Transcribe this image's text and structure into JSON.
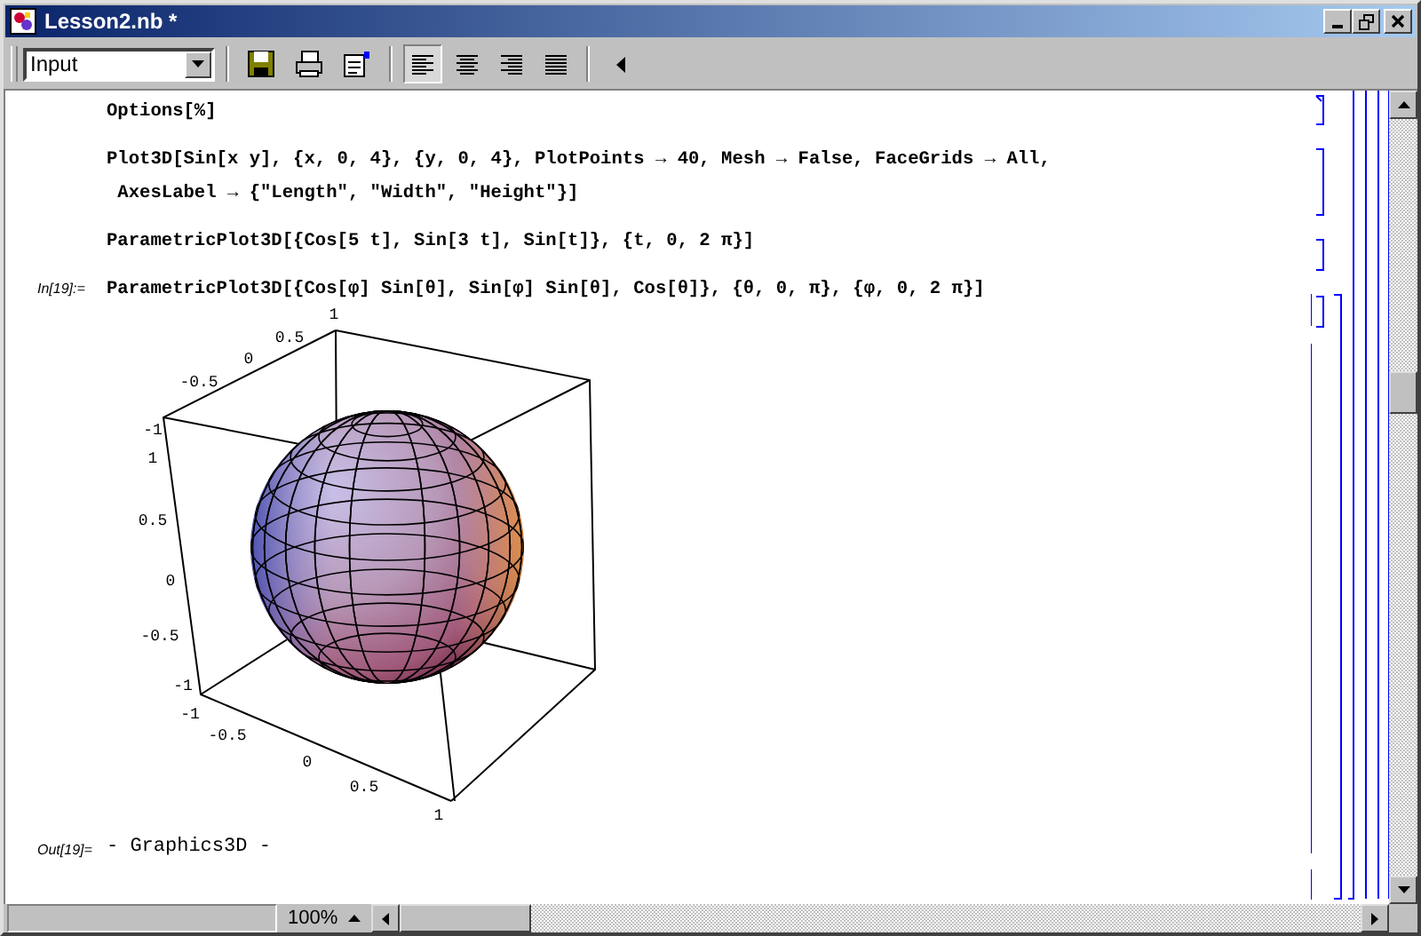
{
  "window": {
    "title": "Lesson2.nb *"
  },
  "toolbar": {
    "style_menu": {
      "value": "Input"
    },
    "align_buttons": [
      {
        "kind": "left",
        "selected": true
      },
      {
        "kind": "center",
        "selected": false
      },
      {
        "kind": "right",
        "selected": false
      },
      {
        "kind": "justify",
        "selected": false
      }
    ]
  },
  "cells": [
    {
      "kind": "input",
      "lines": [
        "Options[%]"
      ]
    },
    {
      "kind": "input",
      "lines": [
        "Plot3D[Sin[x y], {x, 0, 4}, {y, 0, 4}, PlotPoints → 40, Mesh → False, FaceGrids → All,",
        " AxesLabel → {\"Length\", \"Width\", \"Height\"}]"
      ]
    },
    {
      "kind": "input",
      "lines": [
        "ParametricPlot3D[{Cos[5 t], Sin[3 t], Sin[t]}, {t, 0, 2 π}]"
      ]
    },
    {
      "kind": "input",
      "label": "In[19]:=",
      "lines": [
        "ParametricPlot3D[{Cos[φ] Sin[θ], Sin[φ] Sin[θ], Cos[θ]}, {θ, 0, π}, {φ, 0, 2 π}]"
      ]
    },
    {
      "kind": "graphics",
      "axes": [
        {
          "ticks": [
            "1",
            "0.5",
            "0",
            "-0.5",
            "-1"
          ]
        },
        {
          "ticks": [
            "1",
            "0.5",
            "0",
            "-0.5",
            "-1"
          ]
        },
        {
          "ticks": [
            "-1",
            "-0.5",
            "0",
            "0.5",
            "1"
          ]
        }
      ]
    },
    {
      "kind": "output",
      "label": "Out[19]=",
      "text": "- Graphics3D -"
    }
  ],
  "status_bar": {
    "zoom": "100%"
  }
}
